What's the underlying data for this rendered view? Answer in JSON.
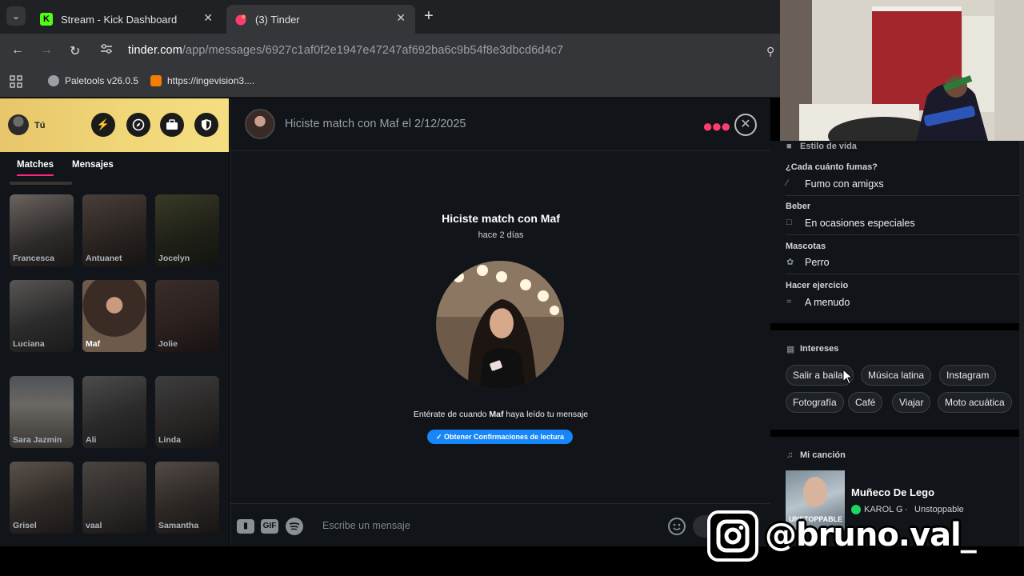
{
  "browser": {
    "tabs": [
      {
        "title": "Stream - Kick Dashboard",
        "icon": "kick-logo-icon"
      },
      {
        "title": "(3) Tinder",
        "icon": "tinder-flame-icon"
      }
    ],
    "url_host": "tinder.com",
    "url_path": "/app/messages/6927c1af0f2e1947e47247af692ba6c9b54f8e3dbcd6d4c7",
    "bookmarks": [
      {
        "label": "Paletools v26.0.5",
        "icon": "globe-icon"
      },
      {
        "label": "https://ingevision3....",
        "icon": "blogger-icon"
      }
    ]
  },
  "sidebar": {
    "me_label": "Tú",
    "tabs": [
      "Matches",
      "Mensajes"
    ],
    "matches": [
      "Francesca",
      "Antuanet",
      "Jocelyn",
      "Luciana",
      "Maf",
      "Jolie",
      "Sara Jazmin",
      "Ali",
      "Linda",
      "Grisel",
      "vaal",
      "Samantha"
    ]
  },
  "chat": {
    "header_title": "Hiciste match con Maf el 2/12/2025",
    "match_prefix": "Hiciste match con ",
    "match_name": "Maf",
    "match_time": "hace 2 días",
    "receipt_prefix": "Entérate de cuando ",
    "receipt_name": "Maf",
    "receipt_suffix": " haya leído tu mensaje",
    "receipt_button": "Obtener Confirmaciones de lectura",
    "composer_placeholder": "Escribe un mensaje",
    "gif_label": "GIF"
  },
  "profile": {
    "lifestyle_title": "Estilo de vida",
    "lifestyle": [
      {
        "label": "¿Cada cuánto fumas?",
        "value": "Fumo con amigxs",
        "icon": "smoking-icon"
      },
      {
        "label": "Beber",
        "value": "En ocasiones especiales",
        "icon": "wine-glass-icon"
      },
      {
        "label": "Mascotas",
        "value": "Perro",
        "icon": "paw-icon"
      },
      {
        "label": "Hacer ejercicio",
        "value": "A menudo",
        "icon": "dumbbell-icon"
      }
    ],
    "interests_title": "Intereses",
    "interests": [
      "Salir a bailar",
      "Música latina",
      "Instagram",
      "Fotografía",
      "Café",
      "Viajar",
      "Moto acuática"
    ],
    "song_title": "Mi canción",
    "song_name": "Muñeco De Lego",
    "song_artist": "KAROL G",
    "song_album": "Unstoppable",
    "album_art_text": "UNSTOPPABLE"
  },
  "overlay": {
    "instagram_handle": "@bruno.val_"
  },
  "colors": {
    "tinder_pink": "#fd267a",
    "read_receipt_blue": "#1786f8",
    "spotify_green": "#1ed760",
    "kick_green": "#53fc18"
  }
}
